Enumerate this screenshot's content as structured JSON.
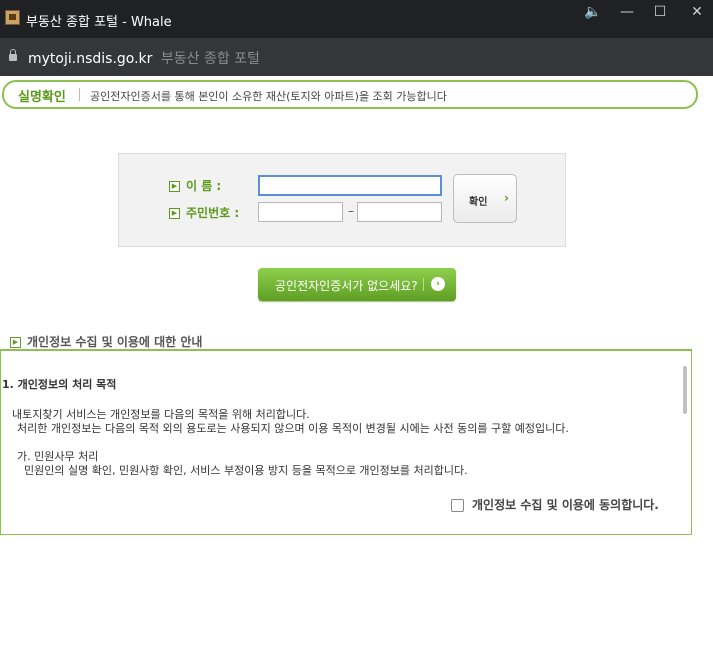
{
  "window": {
    "title": "부동산 종합 포털 - Whale",
    "controls": {
      "speaker": "🔈",
      "minimize": "—",
      "maximize": "☐",
      "close": "✕"
    }
  },
  "address_bar": {
    "domain": "mytoji.nsdis.go.kr",
    "page_title": "부동산 종합 포털"
  },
  "notice": {
    "label": "실명확인",
    "text": "공인전자인증서를 통해 본인이 소유한 재산(토지와 아파트)을 조회 가능합니다"
  },
  "form": {
    "name_label": "이      름 :",
    "id_label": "주민번호 :",
    "name_value": "",
    "id_front_value": "",
    "id_back_value": "",
    "dash": "–",
    "confirm_label": "확인",
    "confirm_chevron": "›",
    "arrow_glyph": "▶"
  },
  "cert_button": {
    "label": "공인전자인증서가 없으세요?",
    "icon": "›"
  },
  "privacy": {
    "section_title": "개인정보 수집 및 이용에 대한 안내",
    "heading": "1. 개인정보의 처리 목적",
    "lines": [
      "내토지찾기 서비스는 개인정보를 다음의 목적을 위해 처리합니다.",
      "처리한 개인정보는 다음의 목적 외의 용도로는 사용되지 않으며 이용 목적이 변경될 시에는 사전 동의를 구할 예정입니다.",
      "가. 민원사무 처리",
      "민원인의 실명 확인, 민원사항 확인, 서비스 부정이용 방지 등을 목적으로 개인정보를 처리합니다."
    ],
    "agree_label": "개인정보 수집 및 이용에 동의합니다."
  },
  "colors": {
    "accent": "#5b9a1b",
    "border_green": "#8cc152",
    "titlebar": "#202124",
    "urlbar": "#35363a"
  }
}
